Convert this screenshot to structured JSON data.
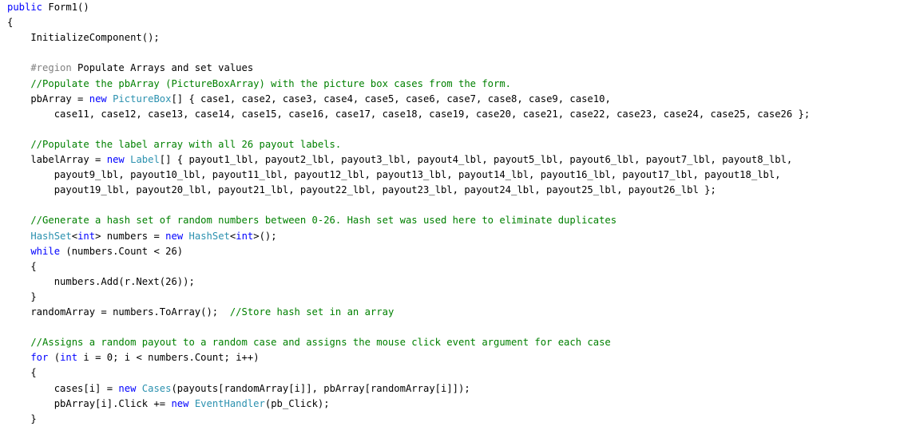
{
  "editor": {
    "colors": {
      "keyword": "#0000ff",
      "type": "#2b91af",
      "comment": "#008000",
      "preprocessor": "#808080",
      "text": "#000000",
      "background": "#ffffff"
    },
    "lines": [
      [
        {
          "t": "kw",
          "v": "public"
        },
        {
          "t": "tx",
          "v": " Form1()"
        }
      ],
      [
        {
          "t": "tx",
          "v": "{"
        }
      ],
      [
        {
          "t": "tx",
          "v": "    InitializeComponent();"
        }
      ],
      [],
      [
        {
          "t": "pp",
          "v": "    #region"
        },
        {
          "t": "tx",
          "v": " Populate Arrays and set values"
        }
      ],
      [
        {
          "t": "cm",
          "v": "    //Populate the pbArray (PictureBoxArray) with the picture box cases from the form."
        }
      ],
      [
        {
          "t": "tx",
          "v": "    pbArray = "
        },
        {
          "t": "kw",
          "v": "new"
        },
        {
          "t": "tx",
          "v": " "
        },
        {
          "t": "ty",
          "v": "PictureBox"
        },
        {
          "t": "tx",
          "v": "[] { case1, case2, case3, case4, case5, case6, case7, case8, case9, case10,"
        }
      ],
      [
        {
          "t": "tx",
          "v": "        case11, case12, case13, case14, case15, case16, case17, case18, case19, case20, case21, case22, case23, case24, case25, case26 };"
        }
      ],
      [],
      [
        {
          "t": "cm",
          "v": "    //Populate the label array with all 26 payout labels."
        }
      ],
      [
        {
          "t": "tx",
          "v": "    labelArray = "
        },
        {
          "t": "kw",
          "v": "new"
        },
        {
          "t": "tx",
          "v": " "
        },
        {
          "t": "ty",
          "v": "Label"
        },
        {
          "t": "tx",
          "v": "[] { payout1_lbl, payout2_lbl, payout3_lbl, payout4_lbl, payout5_lbl, payout6_lbl, payout7_lbl, payout8_lbl,"
        }
      ],
      [
        {
          "t": "tx",
          "v": "        payout9_lbl, payout10_lbl, payout11_lbl, payout12_lbl, payout13_lbl, payout14_lbl, payout16_lbl, payout17_lbl, payout18_lbl,"
        }
      ],
      [
        {
          "t": "tx",
          "v": "        payout19_lbl, payout20_lbl, payout21_lbl, payout22_lbl, payout23_lbl, payout24_lbl, payout25_lbl, payout26_lbl };"
        }
      ],
      [],
      [
        {
          "t": "cm",
          "v": "    //Generate a hash set of random numbers between 0-26. Hash set was used here to eliminate duplicates"
        }
      ],
      [
        {
          "t": "tx",
          "v": "    "
        },
        {
          "t": "ty",
          "v": "HashSet"
        },
        {
          "t": "tx",
          "v": "<"
        },
        {
          "t": "kw",
          "v": "int"
        },
        {
          "t": "tx",
          "v": "> numbers = "
        },
        {
          "t": "kw",
          "v": "new"
        },
        {
          "t": "tx",
          "v": " "
        },
        {
          "t": "ty",
          "v": "HashSet"
        },
        {
          "t": "tx",
          "v": "<"
        },
        {
          "t": "kw",
          "v": "int"
        },
        {
          "t": "tx",
          "v": ">();"
        }
      ],
      [
        {
          "t": "kw",
          "v": "    while"
        },
        {
          "t": "tx",
          "v": " (numbers.Count < 26)"
        }
      ],
      [
        {
          "t": "tx",
          "v": "    {"
        }
      ],
      [
        {
          "t": "tx",
          "v": "        numbers.Add(r.Next(26));"
        }
      ],
      [
        {
          "t": "tx",
          "v": "    }"
        }
      ],
      [
        {
          "t": "tx",
          "v": "    randomArray = numbers.ToArray();  "
        },
        {
          "t": "cm",
          "v": "//Store hash set in an array"
        }
      ],
      [],
      [
        {
          "t": "cm",
          "v": "    //Assigns a random payout to a random case and assigns the mouse click event argument for each case"
        }
      ],
      [
        {
          "t": "kw",
          "v": "    for"
        },
        {
          "t": "tx",
          "v": " ("
        },
        {
          "t": "kw",
          "v": "int"
        },
        {
          "t": "tx",
          "v": " i = 0; i < numbers.Count; i++)"
        }
      ],
      [
        {
          "t": "tx",
          "v": "    {"
        }
      ],
      [
        {
          "t": "tx",
          "v": "        cases[i] = "
        },
        {
          "t": "kw",
          "v": "new"
        },
        {
          "t": "tx",
          "v": " "
        },
        {
          "t": "ty",
          "v": "Cases"
        },
        {
          "t": "tx",
          "v": "(payouts[randomArray[i]], pbArray[randomArray[i]]);"
        }
      ],
      [
        {
          "t": "tx",
          "v": "        pbArray[i].Click += "
        },
        {
          "t": "kw",
          "v": "new"
        },
        {
          "t": "tx",
          "v": " "
        },
        {
          "t": "ty",
          "v": "EventHandler"
        },
        {
          "t": "tx",
          "v": "(pb_Click);"
        }
      ],
      [
        {
          "t": "tx",
          "v": "    }"
        }
      ]
    ]
  }
}
